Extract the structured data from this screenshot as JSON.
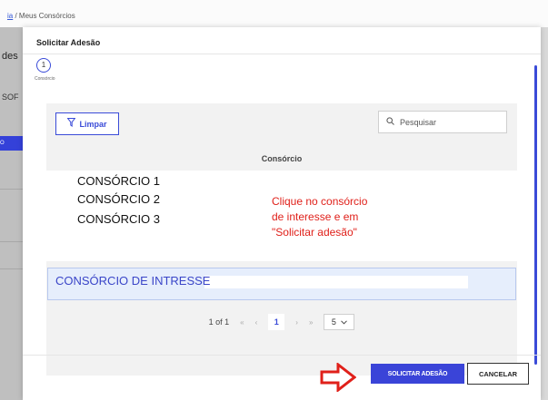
{
  "background": {
    "breadcrumb_link": "ia",
    "breadcrumb_sep": " / ",
    "breadcrumb_current": "Meus Consórcios",
    "side_title": "des",
    "side_sub": "SOF",
    "side_button": "O"
  },
  "modal": {
    "title": "Solicitar Adesão",
    "stepper": {
      "number": "1",
      "label": "Consórcio"
    }
  },
  "toolbar": {
    "clear_label": "Limpar",
    "search_placeholder": "Pesquisar"
  },
  "table": {
    "column_header": "Consórcio",
    "rows": [
      "CONSÓRCIO 1",
      "CONSÓRCIO 2",
      "CONSÓRCIO 3"
    ],
    "selected_row": "CONSÓRCIO DE INTRESSE"
  },
  "hint": "Clique no consórcio\nde interesse e em\n\"Solicitar adesão\"",
  "pagination": {
    "info": "1 of 1",
    "first": "«",
    "prev": "‹",
    "current": "1",
    "next": "›",
    "last": "»",
    "per_page": "5"
  },
  "footer": {
    "submit_label": "SOLICITAR ADESÃO",
    "cancel_label": "CANCELAR"
  },
  "colors": {
    "accent": "#3a44d8",
    "hint": "#e0201a",
    "selected_bg": "#e6eefc"
  }
}
